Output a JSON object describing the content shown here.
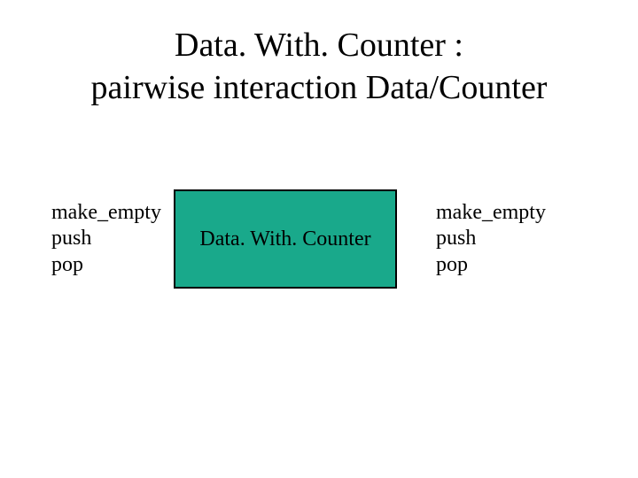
{
  "title_line1": "Data. With. Counter :",
  "title_line2": "pairwise interaction Data/Counter",
  "left_ops": {
    "l1": "make_empty",
    "l2": "push",
    "l3": "pop"
  },
  "right_ops": {
    "l1": "make_empty",
    "l2": "push",
    "l3": "pop"
  },
  "box_label": "Data. With. Counter",
  "colors": {
    "box_fill": "#19a98b",
    "box_border": "#000000"
  }
}
